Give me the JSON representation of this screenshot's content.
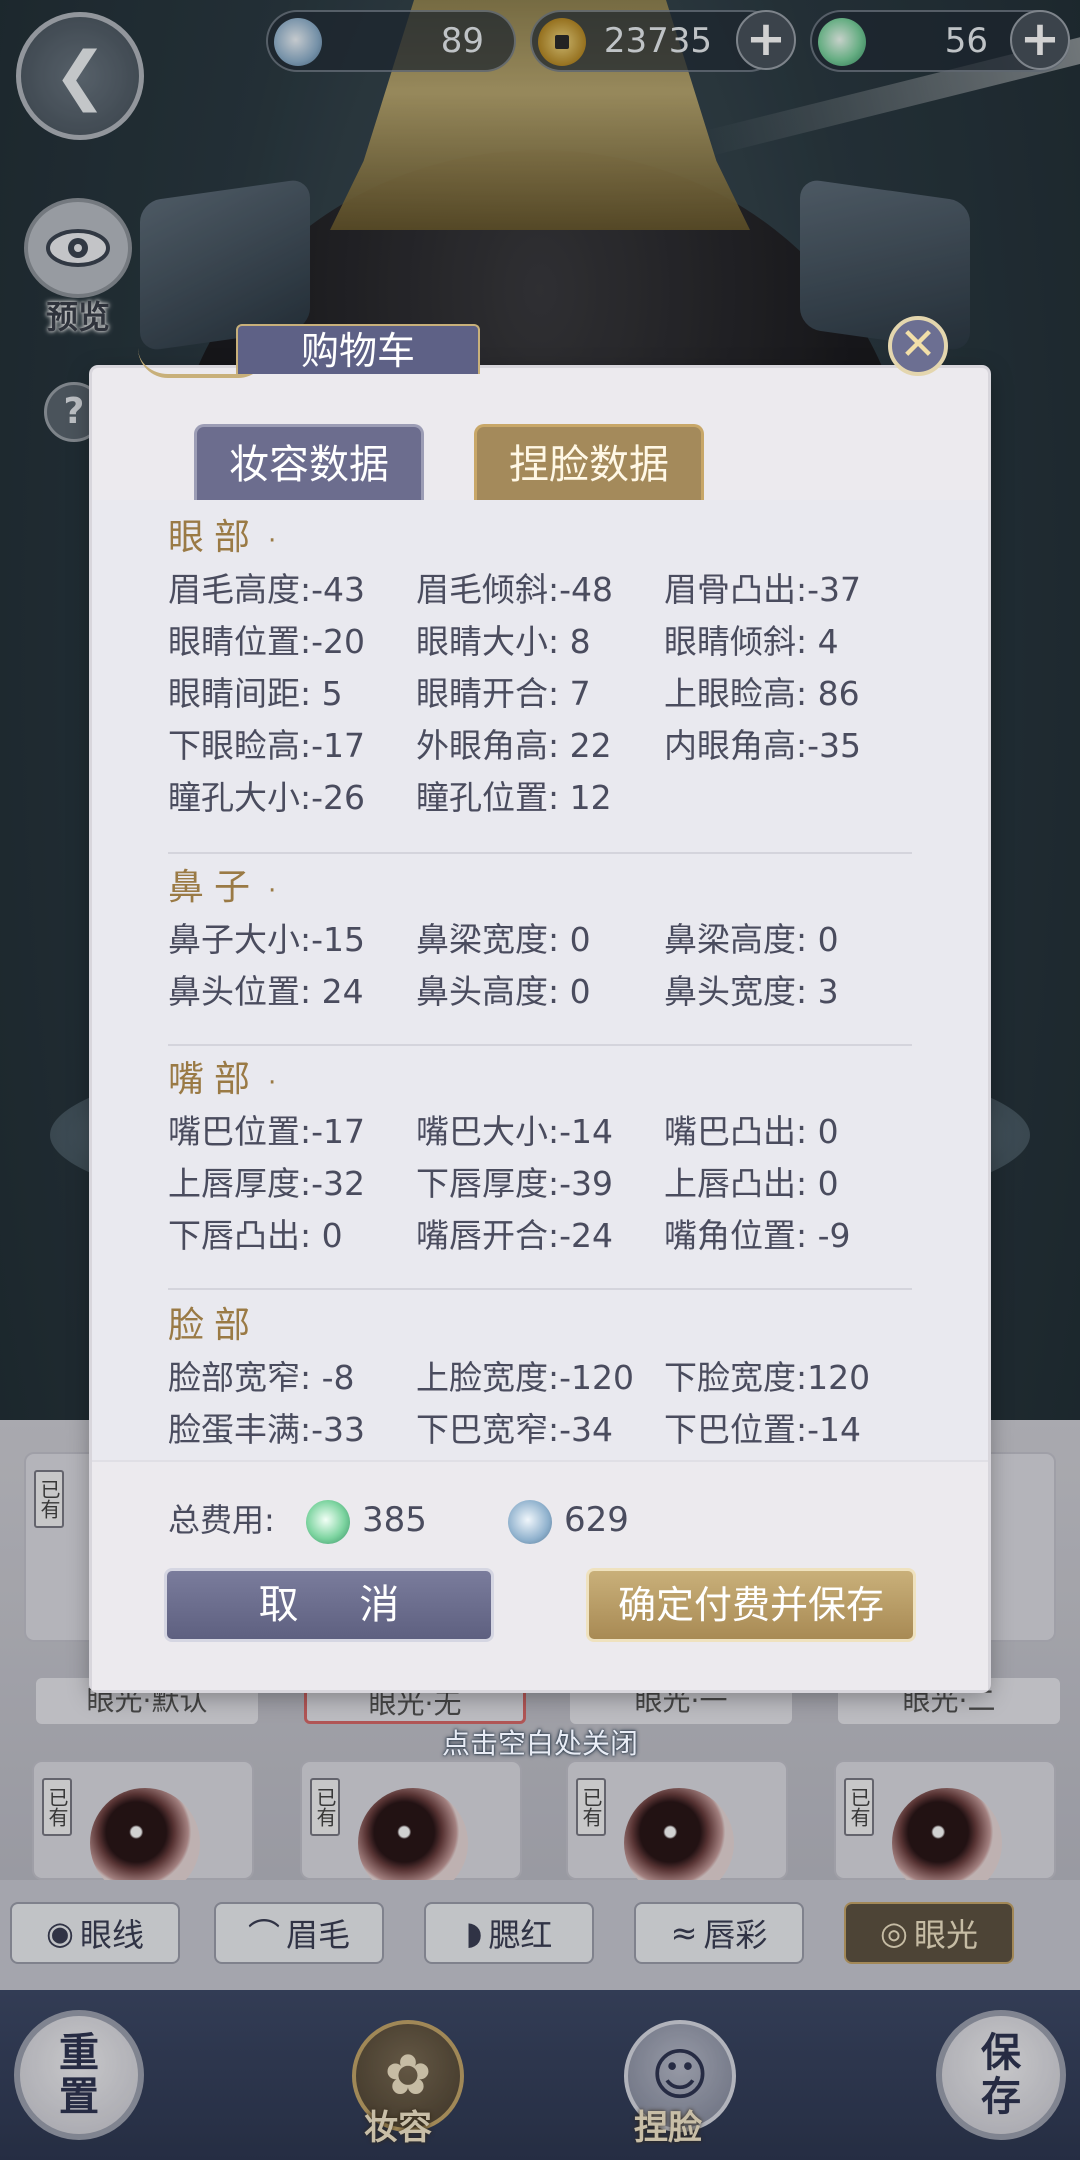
{
  "hud": {
    "currency1_value": "89",
    "currency2_value": "23735",
    "currency3_value": "56",
    "plus_symbol": "+",
    "preview_label": "预览",
    "help_symbol": "?"
  },
  "modal": {
    "title": "购物车",
    "close_symbol": "✕",
    "tabs": [
      "妆容数据",
      "捏脸数据"
    ],
    "sections": [
      {
        "title": "眼部",
        "marker": "·",
        "items": [
          "眉毛高度:-43",
          "眉毛倾斜:-48",
          "眉骨凸出:-37",
          "眼睛位置:-20",
          "眼睛大小: 8",
          "眼睛倾斜: 4",
          "眼睛间距: 5",
          "眼睛开合: 7",
          "上眼睑高: 86",
          "下眼睑高:-17",
          "外眼角高: 22",
          "内眼角高:-35",
          "瞳孔大小:-26",
          "瞳孔位置: 12"
        ]
      },
      {
        "title": "鼻子",
        "marker": "·",
        "items": [
          "鼻子大小:-15",
          "鼻梁宽度: 0",
          "鼻梁高度: 0",
          "鼻头位置: 24",
          "鼻头高度: 0",
          "鼻头宽度: 3"
        ]
      },
      {
        "title": "嘴部",
        "marker": "·",
        "items": [
          "嘴巴位置:-17",
          "嘴巴大小:-14",
          "嘴巴凸出: 0",
          "上唇厚度:-32",
          "下唇厚度:-39",
          "上唇凸出: 0",
          "下唇凸出: 0",
          "嘴唇开合:-24",
          "嘴角位置: -9"
        ]
      },
      {
        "title": "脸部",
        "marker": "",
        "items": [
          "脸部宽窄: -8",
          "上脸宽度:-120",
          "下脸宽度:120",
          "脸蛋丰满:-33",
          "下巴宽窄:-34",
          "下巴位置:-14"
        ]
      }
    ],
    "total_label": "总费用:",
    "cost_jade": "385",
    "cost_moon": "629",
    "cancel_label": "取 消",
    "confirm_label": "确定付费并保存"
  },
  "tap_hint": "点击空白处关闭",
  "background_panel": {
    "owned_tag": "已有",
    "swatch_labels": [
      "眼光·默认",
      "眼光·无",
      "眼光·一",
      "眼光·二"
    ],
    "category_tabs": [
      "眼线",
      "眉毛",
      "腮红",
      "唇彩",
      "眼光"
    ],
    "active_tab": "眼光"
  },
  "bottom_nav": {
    "reset_label": "重置",
    "makeup_label": "妆容",
    "face_label": "捏脸",
    "save_label": "保存"
  },
  "colors": {
    "modal_bg": "#eceaee",
    "section_title": "#9a7a45",
    "primary_button": "#6c6d8e",
    "accent_gold": "#a88a54"
  }
}
